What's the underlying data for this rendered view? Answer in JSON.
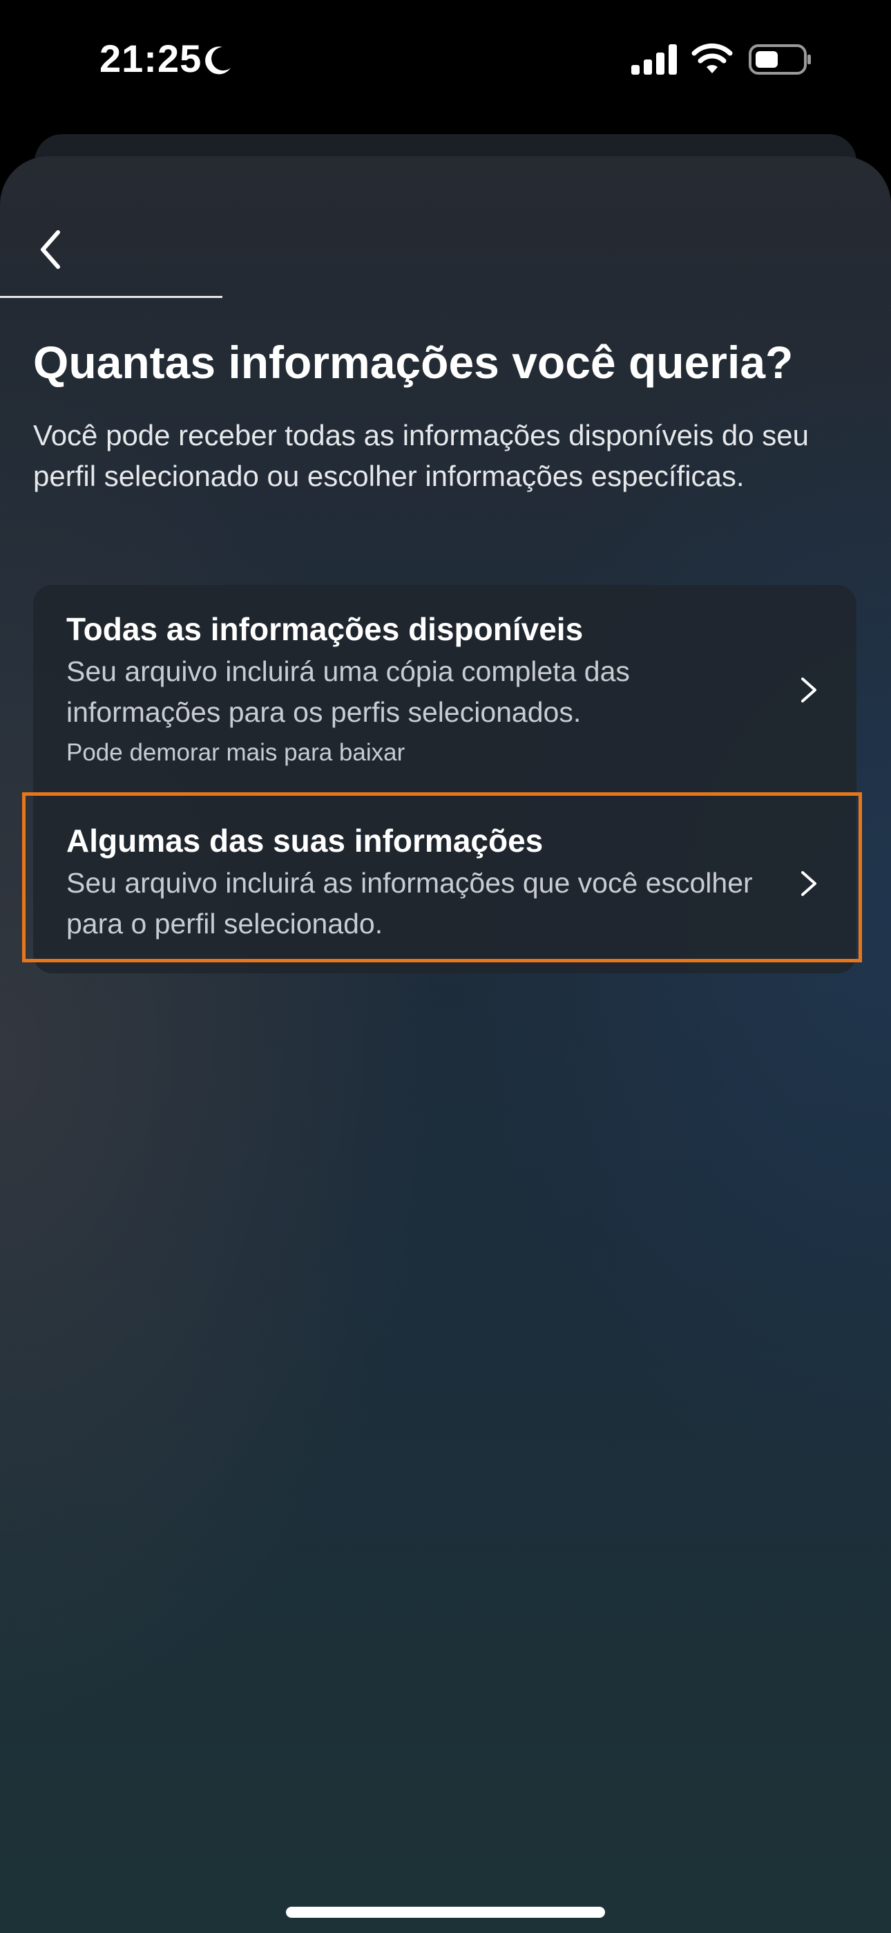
{
  "status_bar": {
    "time": "21:25",
    "icons": [
      "moon-icon",
      "signal-icon",
      "wifi-icon",
      "battery-icon"
    ]
  },
  "header": {
    "back_icon": "chevron-left-icon"
  },
  "page": {
    "title": "Quantas informações você queria?",
    "subtitle": "Você pode receber todas as informações disponíveis do seu perfil selecionado ou escolher informações específicas."
  },
  "options": [
    {
      "title": "Todas as informações disponíveis",
      "description": "Seu arquivo incluirá uma cópia completa das informações para os perfis selecionados.",
      "note": "Pode demorar mais para baixar",
      "icon": "chevron-right-icon"
    },
    {
      "title": "Algumas das suas informações",
      "description": "Seu arquivo incluirá as informações que você escolher para o perfil selecionado.",
      "icon": "chevron-right-icon",
      "highlighted": true
    }
  ],
  "colors": {
    "highlight": "#e8771c",
    "text_primary": "#ffffff",
    "text_secondary": "#c9cdd2"
  }
}
